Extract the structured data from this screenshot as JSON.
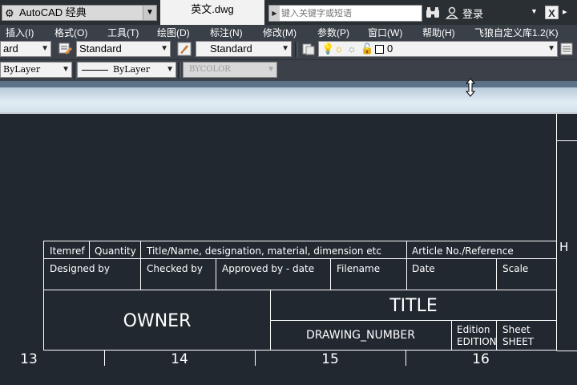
{
  "titlebar": {
    "workspace": "AutoCAD 经典",
    "file_title": "英文.dwg",
    "search_placeholder": "键入关键字或短语",
    "login": "登录"
  },
  "menu": [
    "插入(I)",
    "格式(O)",
    "工具(T)",
    "绘图(D)",
    "标注(N)",
    "修改(M)",
    "参数(P)",
    "窗口(W)",
    "帮助(H)",
    "飞狼自定义库1.2(K)"
  ],
  "toolbar1": {
    "text_style": "ard",
    "dim_style": "Standard",
    "table_style": "Standard",
    "layer": "0"
  },
  "toolbar2": {
    "color": "ByLayer",
    "linetype": "ByLayer",
    "lineweight": "BYCOLOR"
  },
  "drawing": {
    "row1": [
      "Itemref",
      "Quantity",
      "Title/Name, designation, material, dimension etc",
      "Article No./Reference"
    ],
    "row2": [
      "Designed by",
      "Checked by",
      "Approved by - date",
      "Filename",
      "Date",
      "Scale"
    ],
    "owner": "OWNER",
    "title": "TITLE",
    "drawing_number": "DRAWING_NUMBER",
    "edition_label": "Edition",
    "edition_value": "EDITION",
    "sheet_label": "Sheet",
    "sheet_value": "SHEET",
    "grid_row_letter": "H",
    "grid_columns": [
      "13",
      "14",
      "15",
      "16"
    ]
  }
}
